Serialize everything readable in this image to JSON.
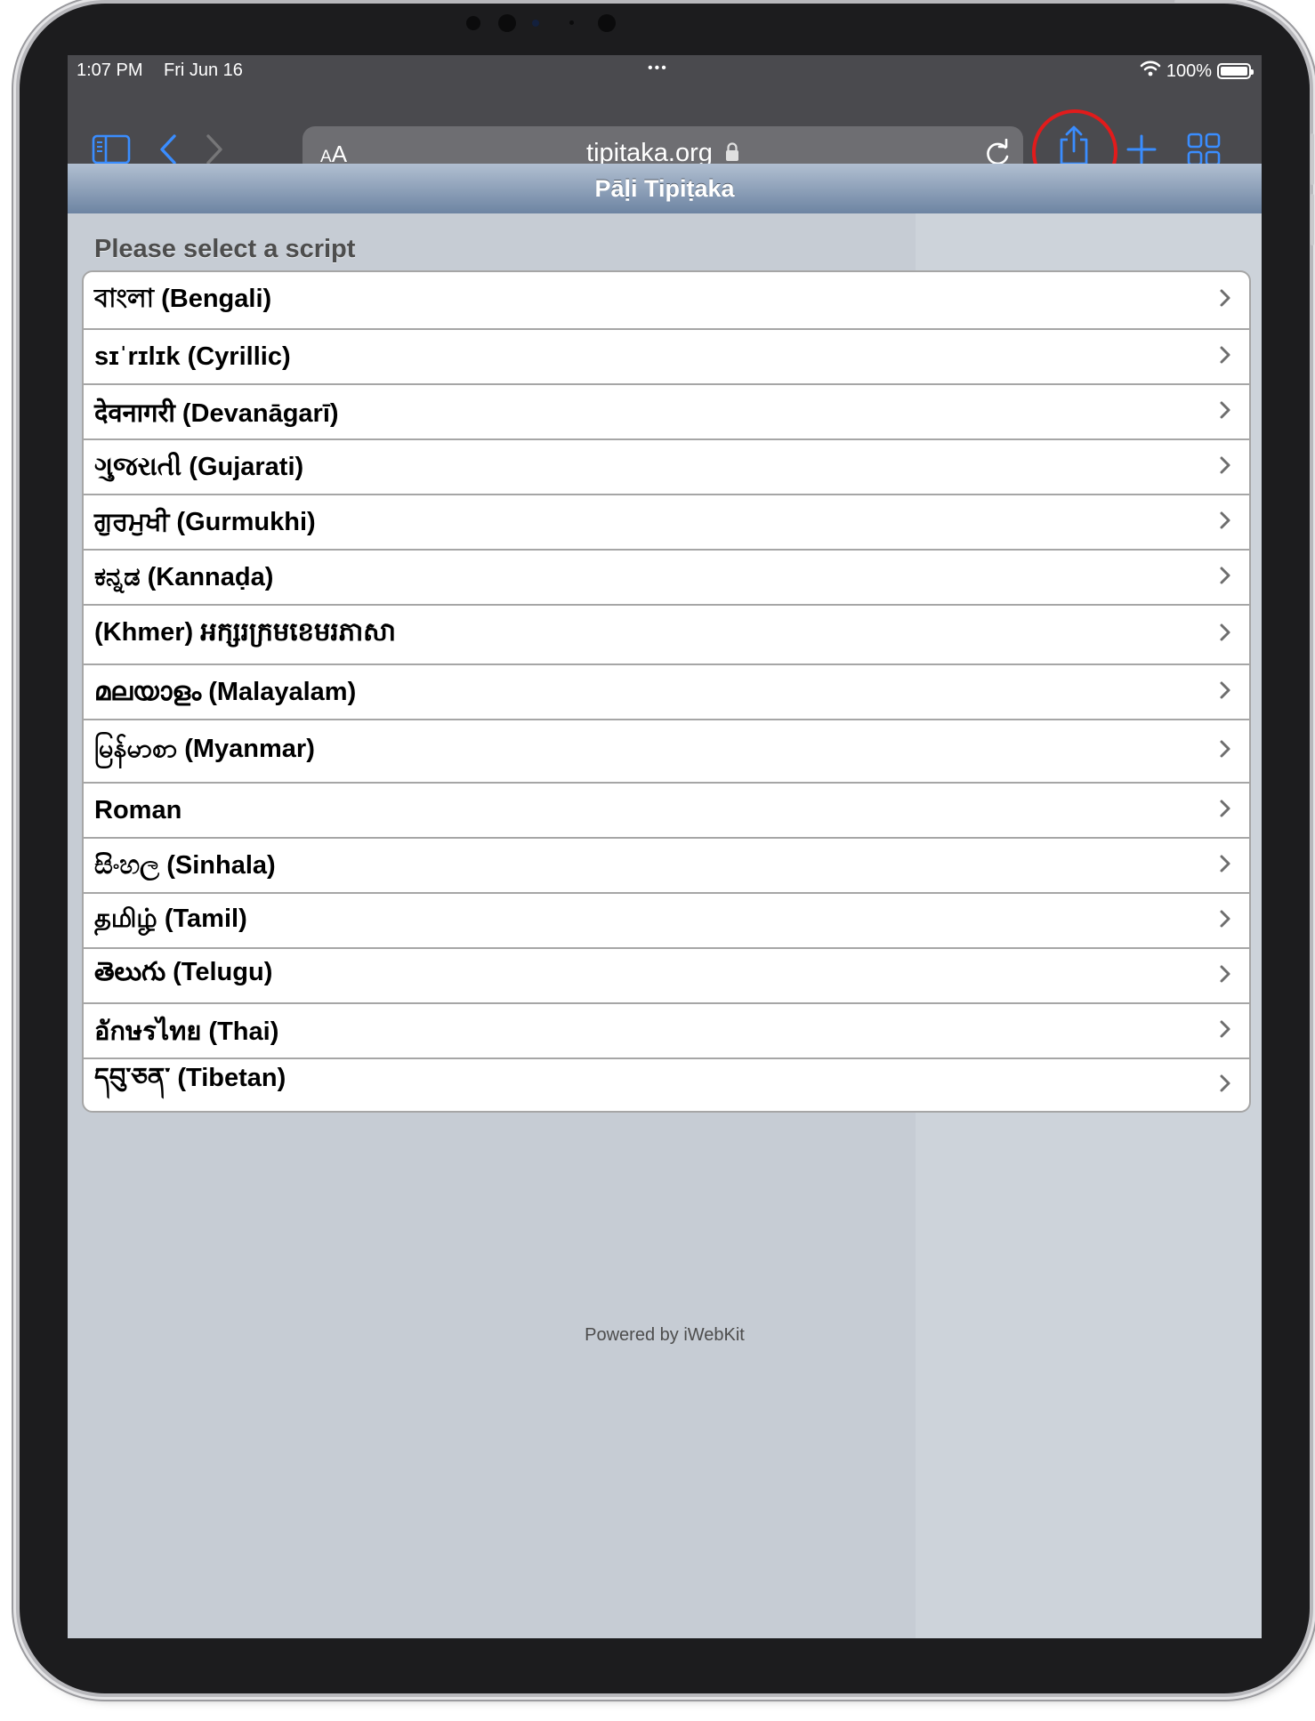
{
  "status_bar": {
    "time": "1:07 PM",
    "date": "Fri Jun 16",
    "multitasking_dots": "•••",
    "battery_percent": "100%",
    "battery_level": 1.0
  },
  "browser": {
    "text_size_label_small": "A",
    "text_size_label_large": "A",
    "url": "tipitaka.org",
    "accent_color": "#3a8dff",
    "highlight_color": "#e21b1b"
  },
  "page": {
    "title": "Pāḷi Tipiṭaka",
    "section_title": "Please select a script",
    "scripts": [
      {
        "label": "বাংলা (Bengali)"
      },
      {
        "label": "sɪˈrɪlɪk (Cyrillic)"
      },
      {
        "label": "देवनागरी (Devanāgarī)"
      },
      {
        "label": "ગુજરાતી (Gujarati)"
      },
      {
        "label": "ਗੁਰਮੁਖੀ (Gurmukhi)"
      },
      {
        "label": "ಕನ್ನಡ (Kannaḍa)"
      },
      {
        "label": "(Khmer) អក្សរក្រមខេមរភាសា"
      },
      {
        "label": "മലയാളം (Malayalam)"
      },
      {
        "label": "မြန်မာစာ (Myanmar)"
      },
      {
        "label": "Roman"
      },
      {
        "label": "සිංහල (Sinhala)"
      },
      {
        "label": "தமிழ் (Tamil)"
      },
      {
        "label": "తెలుగు (Telugu)"
      },
      {
        "label": "อักษรไทย (Thai)"
      },
      {
        "label": "དབུ་ཅན་ (Tibetan)"
      }
    ],
    "footer": "Powered by iWebKit"
  }
}
